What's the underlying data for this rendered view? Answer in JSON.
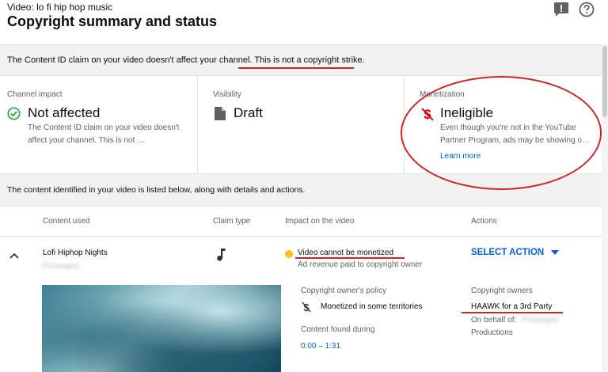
{
  "header": {
    "subtitle": "Video: lo fi hip hop music",
    "title": "Copyright summary and status"
  },
  "notice": {
    "text_plain": "The Content ID claim on your video doesn't affect your channel. ",
    "text_emph": "This is not a copyright strike."
  },
  "cards": {
    "channel_impact": {
      "label": "Channel impact",
      "value": "Not affected",
      "desc": "The Content ID claim on your video doesn't affect your channel. This is not …"
    },
    "visibility": {
      "label": "Visibility",
      "value": "Draft"
    },
    "monetization": {
      "label": "Monetization",
      "value": "Ineligible",
      "desc": "Even though you're not in the YouTube Partner Program, ads may be showing o…",
      "link": "Learn more"
    }
  },
  "content_info": "The content identified in your video is listed below, along with details and actions.",
  "table": {
    "headers": {
      "content_used": "Content used",
      "claim_type": "Claim type",
      "impact": "Impact on the video",
      "actions": "Actions"
    },
    "row": {
      "content_title": "Lofi Hiphop Nights",
      "content_artist": "Proseapro",
      "impact_main": "Video cannot be monetized",
      "impact_sub": "Ad revenue paid to copyright owner",
      "action_label": "SELECT ACTION",
      "policy_label": "Copyright owner's policy",
      "policy_value": "Monetized in some territories",
      "found_label": "Content found during",
      "found_range": "0:00 – 1:31",
      "owners_label": "Copyright owners",
      "owner_name": "HAAWK for a 3rd Party",
      "behalf_label": "On behalf of:",
      "behalf_name": "Proseapro",
      "behalf_suffix": "Productions"
    }
  },
  "colors": {
    "accent_blue": "#065fd4",
    "success_green": "#2ba640",
    "warning_yellow": "#f9c21b",
    "error_red": "#cc0000",
    "annotation_red": "#c62828"
  },
  "icons": {
    "feedback": "feedback-icon",
    "help": "help-icon",
    "check": "check-circle-icon",
    "document": "document-icon",
    "no_money": "dollar-off-icon",
    "music": "music-note-icon",
    "expand": "chevron-up-icon",
    "dropdown": "caret-down-icon",
    "policy": "dollar-off-small-icon"
  }
}
